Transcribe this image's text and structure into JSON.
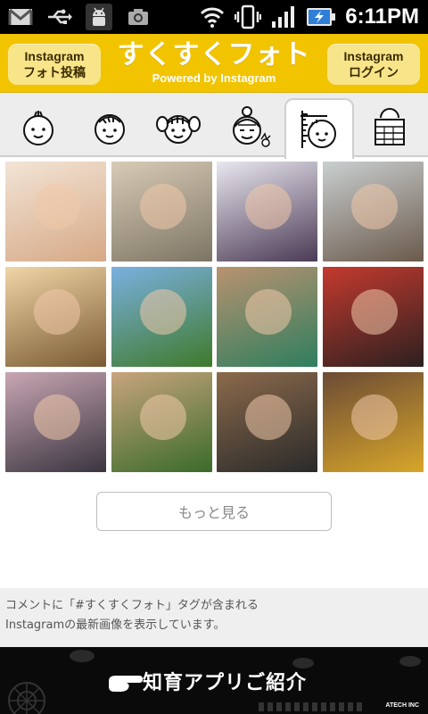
{
  "status_bar": {
    "time": "6:11PM",
    "left_icons": [
      "gmail-icon",
      "usb-icon",
      "android-debug-icon",
      "camera-icon"
    ],
    "right_icons": [
      "wifi-icon",
      "vibrate-icon",
      "signal-icon",
      "battery-charging-icon"
    ]
  },
  "header": {
    "left_button": {
      "line1": "Instagram",
      "line2": "フォト投稿"
    },
    "title": "すくすくフォト",
    "subtitle": "Powered by Instagram",
    "right_button": {
      "line1": "Instagram",
      "line2": "ログイン"
    },
    "colors": {
      "bar": "#f2c400",
      "button": "#f8e58a"
    }
  },
  "tabs": [
    {
      "name": "baby-face-icon",
      "active": false
    },
    {
      "name": "toddler-face-icon",
      "active": false
    },
    {
      "name": "pigtails-face-icon",
      "active": false
    },
    {
      "name": "grandma-face-icon",
      "active": false
    },
    {
      "name": "height-measure-icon",
      "active": true
    },
    {
      "name": "calendar-icon",
      "active": false
    }
  ],
  "photos": [
    {
      "name": "photo-baby-reaching",
      "colors": [
        "#f2e4d6",
        "#d6a986"
      ]
    },
    {
      "name": "photo-baby-eating",
      "colors": [
        "#d8cbb6",
        "#7d7564"
      ]
    },
    {
      "name": "photo-baby-on-blanket",
      "colors": [
        "#e9e7ef",
        "#4b3a55"
      ]
    },
    {
      "name": "photo-baby-crying",
      "colors": [
        "#c9cfd0",
        "#6b5a4c"
      ]
    },
    {
      "name": "photo-baby-on-cushion",
      "colors": [
        "#f0d6a6",
        "#7a5a33"
      ]
    },
    {
      "name": "photo-park-trees",
      "colors": [
        "#7ab0e0",
        "#3f7a2b"
      ]
    },
    {
      "name": "photo-boy-balloon",
      "colors": [
        "#b99270",
        "#2e7e5e"
      ]
    },
    {
      "name": "photo-boy-birthday-candles",
      "colors": [
        "#c43a2e",
        "#2c2020"
      ]
    },
    {
      "name": "photo-boy-balloon-overhead",
      "colors": [
        "#c8a6b3",
        "#3a3540"
      ]
    },
    {
      "name": "photo-boy-teddy-bear",
      "colors": [
        "#c8a47d",
        "#3a6b2a"
      ]
    },
    {
      "name": "photo-boy-basket-cake",
      "colors": [
        "#8b6a4b",
        "#2a2a2a"
      ]
    },
    {
      "name": "photo-boy-yellow-shirt",
      "colors": [
        "#6b4b35",
        "#d8a62a"
      ]
    }
  ],
  "more_button": {
    "label": "もっと見る"
  },
  "info": {
    "line1": "コメントに「#すくすくフォト」タグが含まれる",
    "line2": "Instagramの最新画像を表示しています。"
  },
  "banner": {
    "text": "知育アプリご紹介",
    "brand": "ATECH INC"
  }
}
